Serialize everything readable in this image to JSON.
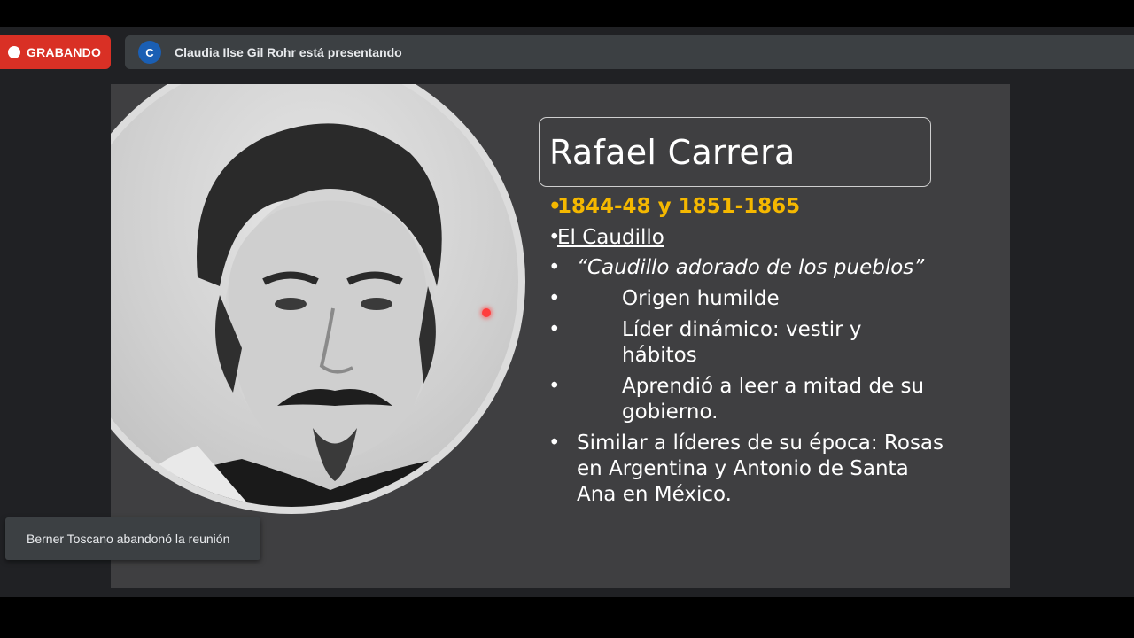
{
  "recording": {
    "label": "GRABANDO",
    "color": "#d93025"
  },
  "presenter": {
    "avatar_letter": "C",
    "text": "Claudia Ilse Gil Rohr está presentando"
  },
  "slide": {
    "title": "Rafael Carrera",
    "bullets": [
      {
        "marker": "•",
        "text": "1844-48 y 1851-1865"
      },
      {
        "marker": "•",
        "text": "El Caudillo"
      },
      {
        "marker": "•",
        "text": "“Caudillo adorado de los pueblos”"
      },
      {
        "marker": "•",
        "text": "Origen humilde"
      },
      {
        "marker": "•",
        "line1": "Líder dinámico: vestir y",
        "line2": "hábitos"
      },
      {
        "marker": "•",
        "line1": "Aprendió a leer a mitad de su",
        "line2": "gobierno."
      },
      {
        "marker": "•",
        "line1": "Similar a líderes de su época: Rosas",
        "line2": "en Argentina  y Antonio de Santa",
        "line3": "Ana en México."
      }
    ],
    "highlight_color": "#f5b800"
  },
  "notification": {
    "text": "Berner Toscano abandonó la reunión"
  }
}
